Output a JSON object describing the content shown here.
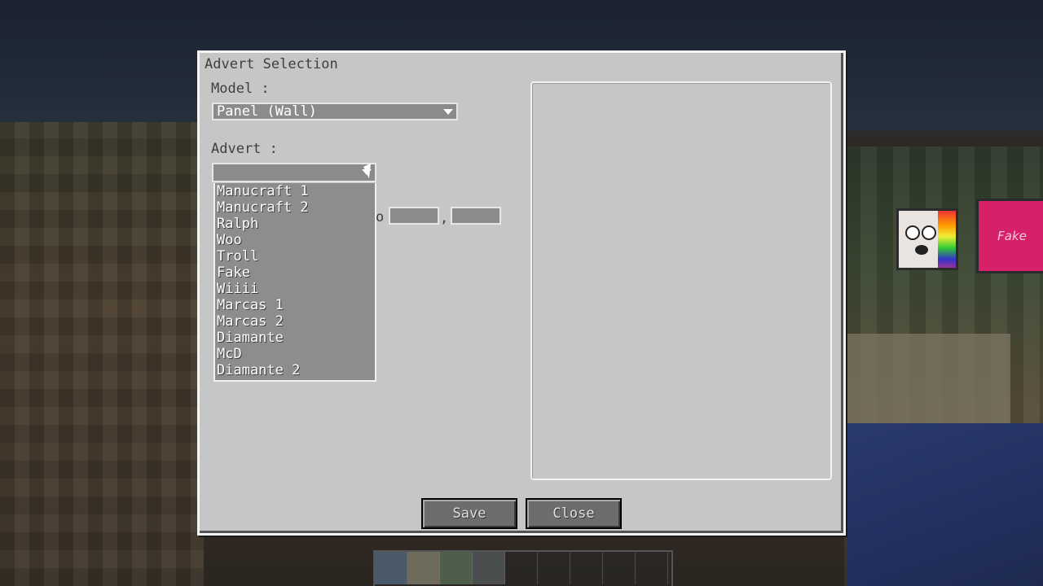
{
  "dialog": {
    "title": "Advert Selection",
    "model_label": "Model :",
    "model_value": "Panel (Wall)",
    "advert_label": "Advert :",
    "advert_value": "",
    "advert_options": [
      "Manucraft 1",
      "Manucraft 2",
      "Ralph",
      "Woo",
      "Troll",
      "Fake",
      "Wiiii",
      "Marcas 1",
      "Marcas 2",
      "Diamante",
      "McD",
      "Diamante 2"
    ],
    "partial_glyph": "o",
    "comma": ",",
    "save_label": "Save",
    "close_label": "Close"
  },
  "scene": {
    "fake_sign_text": "Fake"
  },
  "colors": {
    "panel": "#c6c6c6",
    "field": "#8b8b8b",
    "button": "#6d6d6d"
  }
}
